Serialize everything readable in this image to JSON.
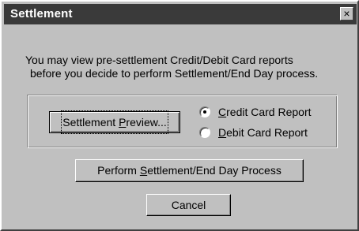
{
  "window": {
    "title": "Settlement",
    "close_glyph": "×"
  },
  "message": {
    "line1": "You may view pre-settlement Credit/Debit Card reports",
    "line2": "before you decide to  perform Settlement/End Day process."
  },
  "preview_button": {
    "pre": "Settlement ",
    "mnemonic": "P",
    "post": "review..."
  },
  "report_options": [
    {
      "mnemonic": "C",
      "rest": "redit Card Report",
      "selected": true
    },
    {
      "mnemonic": "D",
      "rest": "ebit Card Report",
      "selected": false
    }
  ],
  "perform_button": {
    "pre": "Perform ",
    "mnemonic": "S",
    "post": "ettlement/End Day Process"
  },
  "cancel_button": {
    "label": "Cancel"
  }
}
